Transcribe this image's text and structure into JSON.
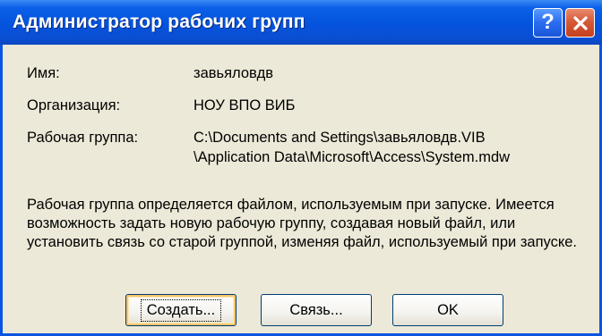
{
  "window": {
    "title": "Администратор рабочих групп",
    "help_glyph": "?",
    "close_icon": "close-icon",
    "help_icon": "help-icon"
  },
  "info": {
    "name_label": "Имя:",
    "name_value": "завьяловдв",
    "org_label": "Организация:",
    "org_value": "НОУ ВПО ВИБ",
    "workgroup_label": "Рабочая группа:",
    "workgroup_value_line1": "C:\\Documents and Settings\\завьяловдв.VIB",
    "workgroup_value_line2": "\\Application Data\\Microsoft\\Access\\System.mdw"
  },
  "description": "Рабочая группа определяется файлом, используемым при запуске. Имеется возможность задать новую рабочую группу, создавая новый файл, или установить связь со старой группой, изменяя файл, используемый при запуске.",
  "buttons": {
    "create": "Создать...",
    "link": "Связь...",
    "ok": "OK"
  },
  "colors": {
    "titlebar": "#0553dc",
    "window_bg": "#ece9d8",
    "close_button": "#d75a38"
  }
}
